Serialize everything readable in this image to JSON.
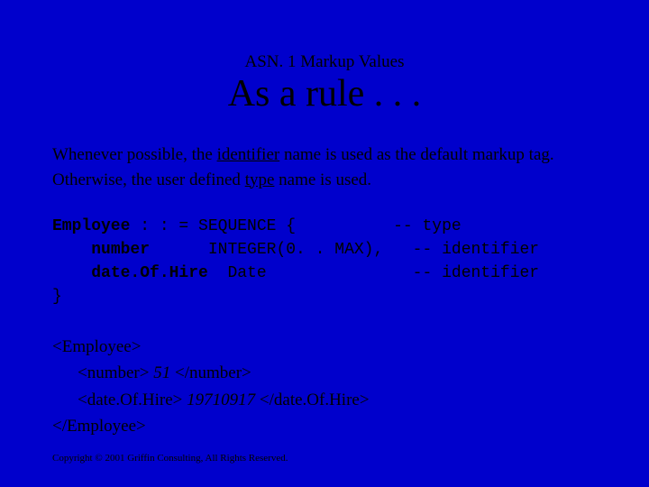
{
  "supertitle": "ASN. 1 Markup Values",
  "title": "As a rule . . .",
  "body": {
    "p1_a": "Whenever possible, the ",
    "p1_u": "identifier",
    "p1_b": " name is used as the default markup tag.",
    "p2_a": "Otherwise, the user defined ",
    "p2_u": "type",
    "p2_b": " name is used."
  },
  "code": {
    "l1_a": "Employee",
    "l1_b": " : : = SEQUENCE {          -- type",
    "l2_a": "    ",
    "l2_b": "number",
    "l2_c": "      INTEGER(0. . MAX),   -- identifier",
    "l3_a": "    ",
    "l3_b": "date.Of.Hire",
    "l3_c": "  Date               -- identifier",
    "l4": "}"
  },
  "xml": {
    "l1": "<Employee>",
    "l2_a": "<number> ",
    "l2_i": "51",
    "l2_b": " </number>",
    "l3_a": "<date.Of.Hire> ",
    "l3_i": "19710917",
    "l3_b": " </date.Of.Hire>",
    "l4": "</Employee>"
  },
  "footer": "Copyright © 2001 Griffin Consulting, All Rights Reserved."
}
